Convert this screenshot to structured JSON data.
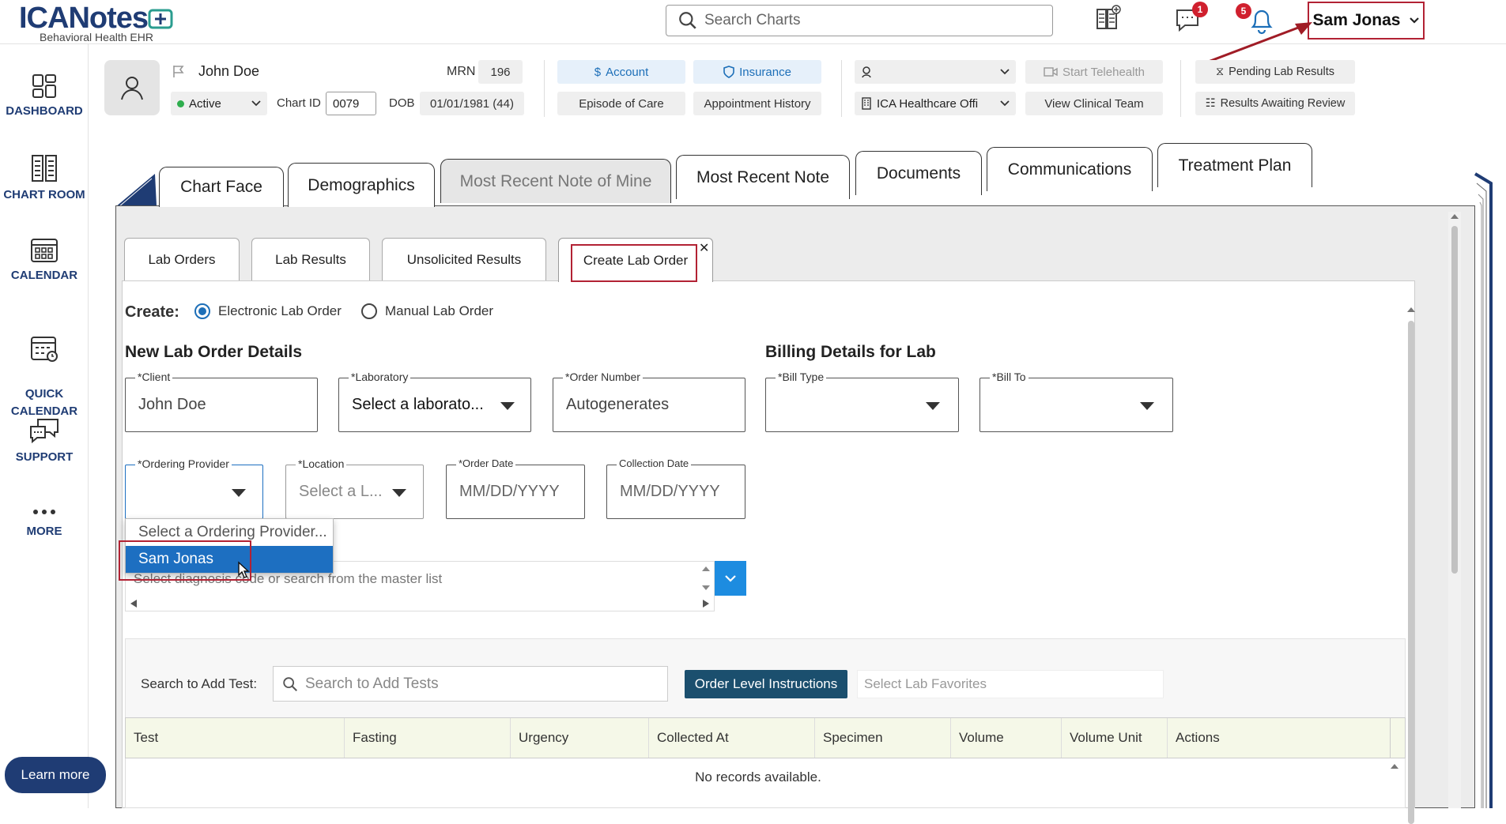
{
  "brand": {
    "name": "ICANotes",
    "tagline": "Behavioral Health EHR"
  },
  "topbar": {
    "search_placeholder": "Search Charts",
    "messages_badge": "1",
    "notifications_badge": "5",
    "user_name": "Sam Jonas"
  },
  "leftnav": {
    "items": [
      {
        "label": "DASHBOARD",
        "icon": "dashboard-icon"
      },
      {
        "label": "CHART ROOM",
        "icon": "chart-room-icon"
      },
      {
        "label": "CALENDAR",
        "icon": "calendar-icon"
      },
      {
        "label": "QUICK\nCALENDAR",
        "icon": "quick-calendar-icon"
      },
      {
        "label": "SUPPORT",
        "icon": "support-icon"
      },
      {
        "label": "MORE",
        "icon": "more-icon"
      }
    ],
    "learn_more": "Learn more"
  },
  "patient": {
    "name": "John Doe",
    "status": "Active",
    "mrn_label": "MRN",
    "mrn": "196",
    "chart_id_label": "Chart ID",
    "chart_id": "0079",
    "dob_label": "DOB",
    "dob": "01/01/1981 (44)"
  },
  "header_buttons": {
    "account": "Account",
    "insurance": "Insurance",
    "episode": "Episode of Care",
    "appointment_history": "Appointment History",
    "provider_select": "",
    "office": "ICA Healthcare Offi",
    "start_telehealth": "Start Telehealth",
    "view_clinical_team": "View Clinical Team",
    "pending_lab": "Pending Lab Results",
    "results_awaiting": "Results Awaiting Review"
  },
  "chart_tabs": [
    "Chart Face",
    "Demographics",
    "Most Recent Note of Mine",
    "Most Recent Note",
    "Documents",
    "Communications",
    "Treatment Plan"
  ],
  "sub_tabs": [
    "Lab Orders",
    "Lab Results",
    "Unsolicited Results",
    "Create Lab Order"
  ],
  "create": {
    "label": "Create:",
    "electronic": "Electronic Lab Order",
    "manual": "Manual Lab Order",
    "selected": "Electronic Lab Order"
  },
  "order_details": {
    "title": "New Lab Order Details",
    "client_label": "*Client",
    "client_value": "John Doe",
    "laboratory_label": "*Laboratory",
    "laboratory_value": "Select a laborato...",
    "order_number_label": "*Order Number",
    "order_number_value": "Autogenerates",
    "ordering_provider_label": "*Ordering Provider",
    "location_label": "*Location",
    "location_value": "Select a L...",
    "order_date_label": "*Order Date",
    "order_date_value": "MM/DD/YYYY",
    "collection_date_label": "Collection Date",
    "collection_date_value": "MM/DD/YYYY"
  },
  "billing": {
    "title": "Billing Details for Lab",
    "bill_type_label": "*Bill Type",
    "bill_to_label": "*Bill To"
  },
  "provider_dropdown": {
    "placeholder": "Select a Ordering Provider...",
    "options": [
      "Sam Jonas"
    ],
    "highlighted": "Sam Jonas"
  },
  "diagnosis": {
    "placeholder": "Select diagnosis code or search from the master list"
  },
  "tests": {
    "search_label": "Search to Add Test:",
    "search_placeholder": "Search to Add Tests",
    "order_instructions": "Order Level Instructions",
    "favorites_placeholder": "Select Lab Favorites",
    "columns": [
      "Test",
      "Fasting",
      "Urgency",
      "Collected At",
      "Specimen",
      "Volume",
      "Volume Unit",
      "Actions"
    ],
    "empty": "No records available."
  },
  "colors": {
    "brand_navy": "#1f3c74",
    "highlight_red": "#b22234",
    "selection_blue": "#1d6fc1",
    "button_dark": "#1b4f6e"
  }
}
